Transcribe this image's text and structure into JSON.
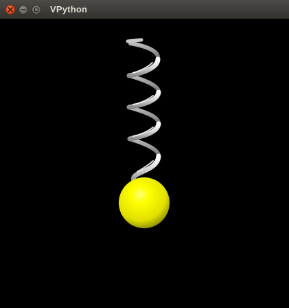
{
  "window": {
    "title": "VPython"
  },
  "titlebar_buttons": {
    "close_icon": "close-icon",
    "minimize_icon": "minimize-icon",
    "maximize_icon": "maximize-icon"
  },
  "scene": {
    "background_color": "#000000",
    "spring_color": "#d9d9d9",
    "ball_color": "#ffff00"
  }
}
